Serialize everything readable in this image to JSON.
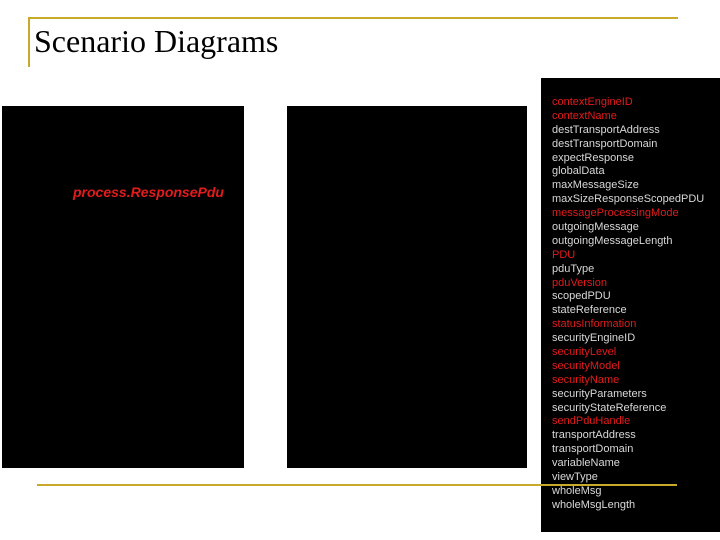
{
  "slide": {
    "title": "Scenario Diagrams"
  },
  "panel_1": {
    "label": "process.ResponsePdu"
  },
  "parameters": [
    {
      "name": "contextEngineID",
      "color": "#e31b1b"
    },
    {
      "name": "contextName",
      "color": "#e31b1b"
    },
    {
      "name": "destTransportAddress",
      "color": "#d8d8d8"
    },
    {
      "name": "destTransportDomain",
      "color": "#d8d8d8"
    },
    {
      "name": "expectResponse",
      "color": "#d8d8d8"
    },
    {
      "name": "globalData",
      "color": "#d8d8d8"
    },
    {
      "name": "maxMessageSize",
      "color": "#d8d8d8"
    },
    {
      "name": "maxSizeResponseScopedPDU",
      "color": "#d8d8d8"
    },
    {
      "name": "messageProcessingMode",
      "color": "#e31b1b"
    },
    {
      "name": "outgoingMessage",
      "color": "#d8d8d8"
    },
    {
      "name": "outgoingMessageLength",
      "color": "#d8d8d8"
    },
    {
      "name": "PDU",
      "color": "#e31b1b"
    },
    {
      "name": "pduType",
      "color": "#d8d8d8"
    },
    {
      "name": "pduVersion",
      "color": "#e31b1b"
    },
    {
      "name": "scopedPDU",
      "color": "#d8d8d8"
    },
    {
      "name": "stateReference",
      "color": "#d8d8d8"
    },
    {
      "name": "statusInformation",
      "color": "#e31b1b"
    },
    {
      "name": "securityEngineID",
      "color": "#d8d8d8"
    },
    {
      "name": "securityLevel",
      "color": "#e31b1b"
    },
    {
      "name": "securityModel",
      "color": "#e31b1b"
    },
    {
      "name": "securityName",
      "color": "#e31b1b"
    },
    {
      "name": "securityParameters",
      "color": "#d8d8d8"
    },
    {
      "name": "securityStateReference",
      "color": "#d8d8d8"
    },
    {
      "name": "sendPduHandle",
      "color": "#e31b1b"
    },
    {
      "name": "transportAddress",
      "color": "#d8d8d8"
    },
    {
      "name": "transportDomain",
      "color": "#d8d8d8"
    },
    {
      "name": "variableName",
      "color": "#d8d8d8"
    },
    {
      "name": "viewType",
      "color": "#d8d8d8"
    },
    {
      "name": "wholeMsg",
      "color": "#d8d8d8"
    },
    {
      "name": "wholeMsgLength",
      "color": "#d8d8d8"
    }
  ],
  "colors": {
    "accent_rule": "#c9a92a",
    "panel_background": "#000000",
    "highlight_red": "#e31b1b",
    "normal_gray": "#d8d8d8"
  }
}
